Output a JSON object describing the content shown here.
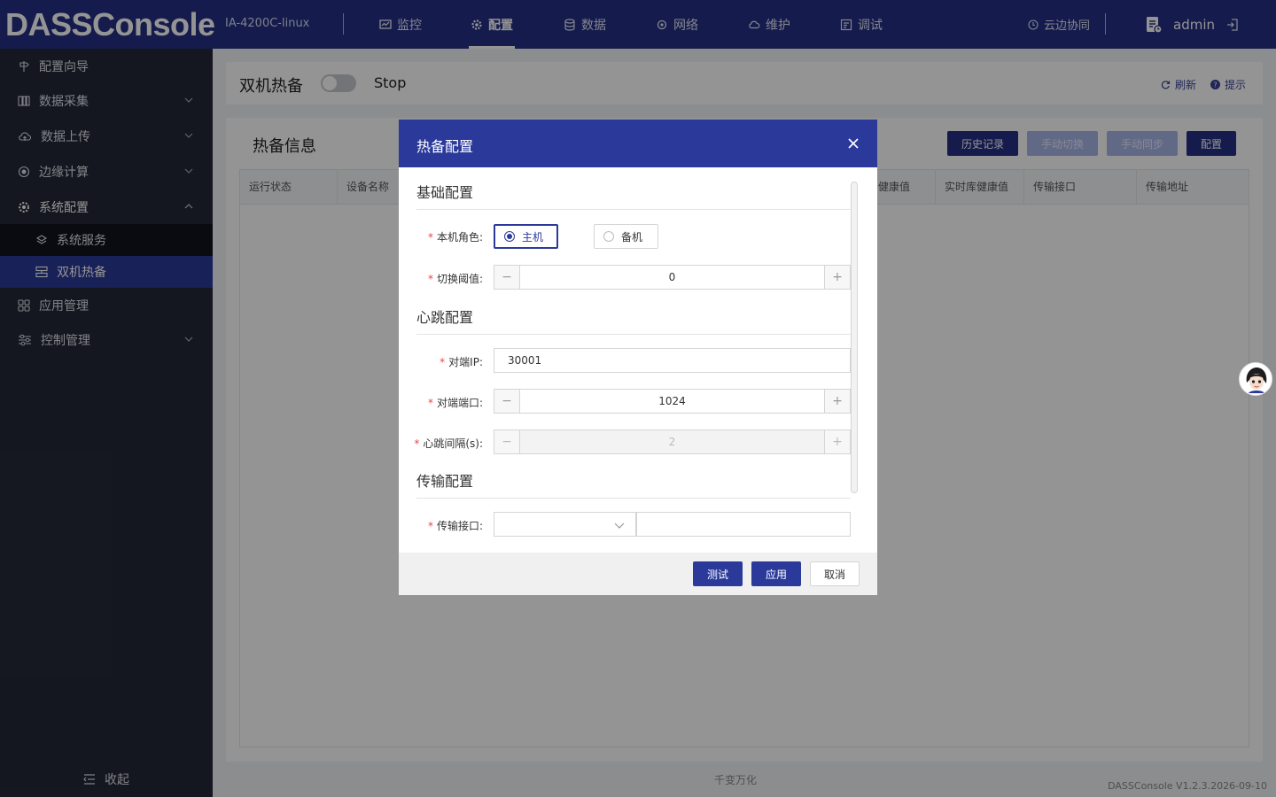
{
  "header": {
    "logo": "DASSConsole",
    "device": "IA-4200C-linux",
    "nav": [
      {
        "label": "监控",
        "icon": "monitor-icon"
      },
      {
        "label": "配置",
        "icon": "gear-icon"
      },
      {
        "label": "数据",
        "icon": "database-icon"
      },
      {
        "label": "网络",
        "icon": "network-icon"
      },
      {
        "label": "维护",
        "icon": "cloud-icon"
      },
      {
        "label": "调试",
        "icon": "debug-icon"
      }
    ],
    "cloud_sync": "云边协同",
    "user": "admin"
  },
  "sidebar": {
    "items": [
      {
        "label": "配置向导"
      },
      {
        "label": "数据采集"
      },
      {
        "label": "数据上传"
      },
      {
        "label": "边缘计算"
      },
      {
        "label": "系统配置"
      },
      {
        "label": "应用管理"
      },
      {
        "label": "控制管理"
      }
    ],
    "sub_items": [
      {
        "label": "系统服务"
      },
      {
        "label": "双机热备"
      }
    ],
    "collapse": "收起"
  },
  "page": {
    "title": "双机热备",
    "status": "Stop",
    "refresh": "刷新",
    "hint": "提示",
    "panel_title": "热备信息",
    "buttons": {
      "history": "历史记录",
      "manual_switch": "手动切换",
      "manual_sync": "手动同步",
      "config": "配置"
    },
    "columns": [
      "运行状态",
      "设备名称",
      "健康值",
      "实时库健康值",
      "传输接口",
      "传输地址"
    ],
    "footer": "千变万化",
    "version": "DASSConsole V1.2.3.2026-09-10"
  },
  "modal": {
    "title": "热备配置",
    "sections": {
      "basic": "基础配置",
      "heartbeat": "心跳配置",
      "transport": "传输配置"
    },
    "fields": {
      "role_label": "本机角色:",
      "role_master": "主机",
      "role_backup": "备机",
      "threshold_label": "切换阈值:",
      "threshold_value": "0",
      "peer_ip_label": "对端IP:",
      "peer_ip_value": "30001",
      "peer_port_label": "对端端口:",
      "peer_port_value": "1024",
      "heartbeat_label": "心跳间隔(s):",
      "heartbeat_value": "2",
      "iface_label": "传输接口:"
    },
    "buttons": {
      "test": "测试",
      "apply": "应用",
      "cancel": "取消"
    }
  }
}
